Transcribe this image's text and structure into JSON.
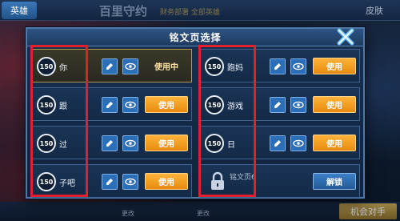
{
  "background": {
    "top_tab": "英雄",
    "title": "百里守约",
    "subtitle": "财务部署 全部英雄",
    "right_tab": "皮肤",
    "bottom_button": "机会对手",
    "bottom_left_label": "更改",
    "bottom_mid_label": "更改"
  },
  "dialog": {
    "title": "铭文页选择",
    "close_icon": "close-icon"
  },
  "slots_left": [
    {
      "level": "150",
      "name": "你",
      "state": "active",
      "status": "使用中"
    },
    {
      "level": "150",
      "name": "跟",
      "state": "normal",
      "button": "使用"
    },
    {
      "level": "150",
      "name": "过",
      "state": "normal",
      "button": "使用"
    },
    {
      "level": "150",
      "name": "子吧",
      "state": "normal",
      "button": "使用"
    }
  ],
  "slots_right": [
    {
      "level": "150",
      "name": "跑妈",
      "state": "normal",
      "button": "使用"
    },
    {
      "level": "150",
      "name": "游戏",
      "state": "normal",
      "button": "使用"
    },
    {
      "level": "150",
      "name": "日",
      "state": "normal",
      "button": "使用"
    },
    {
      "name": "铭文页6",
      "state": "locked",
      "button": "解锁"
    }
  ],
  "colors": {
    "use_button": "#f29a1c",
    "unlock_button": "#2f6fb0",
    "highlight": "#e0202c"
  }
}
